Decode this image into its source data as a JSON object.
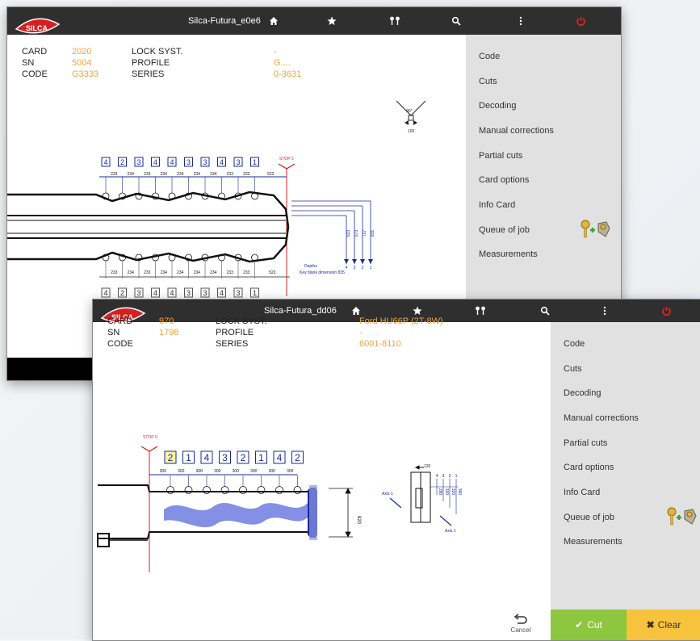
{
  "window1": {
    "title": "Silca-Futura_e0e6",
    "brand": "SILCA",
    "card_label": "CARD",
    "card_value": "2020",
    "sn_label": "SN",
    "sn_value": "5004",
    "code_label": "CODE",
    "code_value": "G3333",
    "lock_label": "LOCK SYST.",
    "lock_value": "-",
    "profile_label": "PROFILE",
    "profile_value": "G....",
    "series_label": "SERIES",
    "series_value": "0-3631",
    "menu": [
      "Code",
      "Cuts",
      "Decoding",
      "Manual corrections",
      "Partial cuts",
      "Card options",
      "Info Card",
      "Queue of job",
      "Measurements"
    ],
    "drawing": {
      "stop": "STOP 3",
      "top_cuts": [
        "4",
        "2",
        "3",
        "4",
        "4",
        "3",
        "3",
        "4",
        "3",
        "1"
      ],
      "bottom_cuts": [
        "4",
        "2",
        "3",
        "4",
        "4",
        "3",
        "3",
        "4",
        "3",
        "1"
      ],
      "spacings": [
        "233",
        "234",
        "233",
        "234",
        "234",
        "234",
        "234",
        "233",
        "233"
      ],
      "last_spacing": "523",
      "depths_label": "Depths",
      "depth_numbers": [
        "4",
        "3",
        "2",
        "1"
      ],
      "depth_values": [
        "623",
        "673",
        "727",
        "831"
      ],
      "blank_dim": "Key blank dimension 835",
      "angle": "90°",
      "angle_sub": "100"
    }
  },
  "window2": {
    "title": "Silca-Futura_dd06",
    "brand": "SILCA",
    "card_label": "CARD",
    "card_value": "970",
    "sn_label": "SN",
    "sn_value": "1798",
    "code_label": "CODE",
    "code_value": "",
    "lock_label": "LOCK SYST.",
    "lock_value": "Ford HU66P (2T-8W)",
    "profile_label": "PROFILE",
    "profile_value": "-",
    "series_label": "SERIES",
    "series_value": "6001-8110",
    "menu": [
      "Code",
      "Cuts",
      "Decoding",
      "Manual corrections",
      "Partial cuts",
      "Card options",
      "Info Card",
      "Queue of job",
      "Measurements"
    ],
    "cut_label": "Cut",
    "clear_label": "Clear",
    "cancel_label": "Cancel",
    "drawing": {
      "stop": "STOP 0",
      "cuts": [
        "2",
        "1",
        "4",
        "3",
        "2",
        "1",
        "4",
        "2"
      ],
      "spacings": [
        "300",
        "300",
        "300",
        "300",
        "300",
        "300",
        "300",
        "300"
      ],
      "height": "820",
      "axis_a": "Axis 1",
      "axis_b": "Axis 1",
      "side_top": "120",
      "side_numbers": [
        "4",
        "3",
        "2",
        "1"
      ],
      "side_values": [
        "280",
        "300",
        "320",
        "360"
      ]
    }
  },
  "colors": {
    "accent": "#f2a33a",
    "topbar": "#2f2f2f",
    "panel": "#e1e1e1",
    "cut": "#8dc63f",
    "clear": "#f7c33d",
    "power": "#e8231f",
    "dim": "#1a2a9a",
    "highlight_cut": "#fff59a"
  },
  "icons": [
    "silca-logo",
    "home-icon",
    "star-icon",
    "key-pair-icon",
    "search-icon",
    "more-vertical-icon",
    "power-icon",
    "queue-keys-icon",
    "undo-icon",
    "check-icon",
    "x-icon"
  ]
}
